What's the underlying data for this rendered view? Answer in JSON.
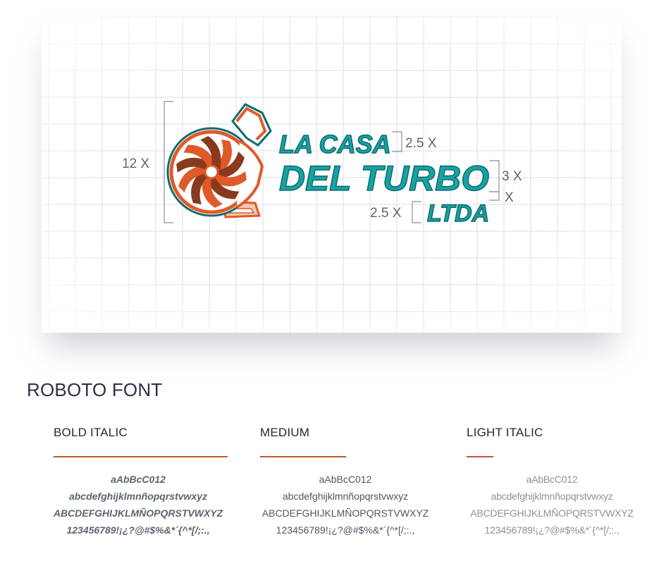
{
  "logo": {
    "line1": "LA CASA",
    "line2": "DEL TURBO",
    "line3": "LTDA",
    "colors": {
      "teal": "#16a3a3",
      "teal_dark": "#0e6b6e",
      "orange": "#e0592a",
      "brown": "#8a3a1c"
    }
  },
  "dimensions": {
    "height_label": "12 X",
    "line1_label": "2.5 X",
    "line2_label": "3 X",
    "gap_label": "X",
    "line3_label": "2.5 X"
  },
  "section": {
    "title": "ROBOTO FONT"
  },
  "fonts": [
    {
      "name": "BOLD ITALIC",
      "lines": [
        "aAbBcC012",
        "abcdefghijklmnñopqrstvwxyz",
        "ABCDEFGHIJKLMÑOPQRSTVWXYZ",
        "123456789!¡¿?@#$%&*´{^*[/;:.,"
      ]
    },
    {
      "name": "MEDIUM",
      "lines": [
        "aAbBcC012",
        "abcdefghijklmnñopqrstvwxyz",
        "ABCDEFGHIJKLMÑOPQRSTVWXYZ",
        "123456789!¡¿?@#$%&*´{^*[/;:.,"
      ]
    },
    {
      "name": "LIGHT ITALIC",
      "lines": [
        "aAbBcC012",
        "abcdefghijklmnñopqrstvwxyz",
        "ABCDEFGHIJKLMÑOPQRSTVWXYZ",
        "123456789!¡¿?@#$%&*´{^*[/;:.,"
      ]
    }
  ],
  "accent_color": "#c45a2b"
}
